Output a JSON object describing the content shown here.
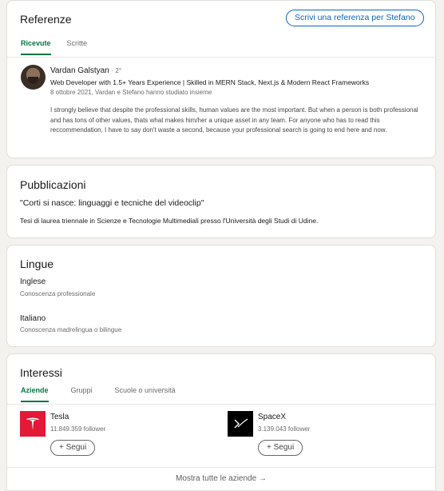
{
  "referenze": {
    "title": "Referenze",
    "write_button": "Scrivi una referenza per Stefano",
    "tabs": [
      "Ricevute",
      "Scritte"
    ],
    "item": {
      "name": "Vardan Galstyan",
      "degree": "· 2°",
      "headline": "Web Developer with 1.5+ Years Experience | Skilled in MERN Stack, Next.js & Modern React Frameworks",
      "meta": "8 ottobre 2021, Vardan e Stefano hanno studiato insieme",
      "text": "I strongly believe that despite the professional skills, human values are the most important. But when a person is both professional and has tons of other values, thats what makes him/her a unique asset in any team. For anyone who has to read this reccommendation, I have to say don't waste a second, because your professional search is going to end here and now."
    }
  },
  "pubblicazioni": {
    "title": "Pubblicazioni",
    "pub_title": "\"Corti si nasce: linguaggi e tecniche del videoclip\"",
    "description": "Tesi di laurea triennale in Scienze e Tecnologie Multimediali presso l'Università degli Studi di Udine."
  },
  "lingue": {
    "title": "Lingue",
    "items": [
      {
        "name": "Inglese",
        "level": "Conoscenza professionale"
      },
      {
        "name": "Italiano",
        "level": "Conoscenza madrelingua o bilingue"
      }
    ]
  },
  "interessi": {
    "title": "Interessi",
    "tabs": [
      "Aziende",
      "Gruppi",
      "Scuole o università"
    ],
    "companies": [
      {
        "name": "Tesla",
        "followers": "11.849.359 follower",
        "follow": "+ Segui",
        "logo": "tesla-logo-icon"
      },
      {
        "name": "SpaceX",
        "followers": "3.139.043 follower",
        "follow": "+ Segui",
        "logo": "spacex-logo-icon"
      }
    ],
    "show_all": "Mostra tutte le aziende →"
  },
  "colors": {
    "accent_green": "#057642",
    "link_blue": "#0a66c2",
    "tesla_red": "#e31937"
  }
}
